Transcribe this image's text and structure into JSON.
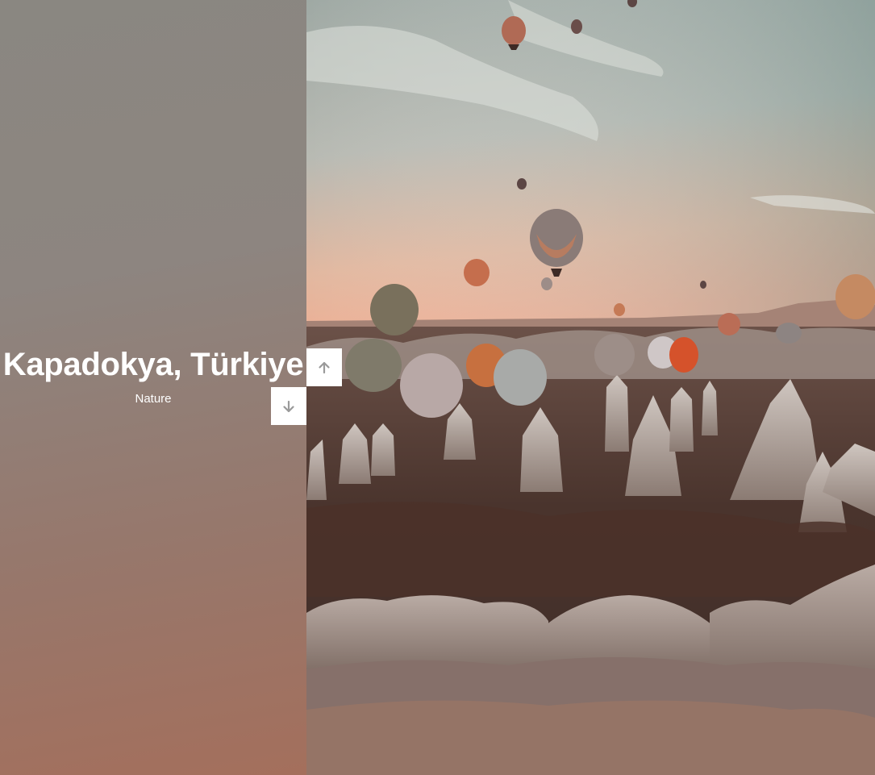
{
  "slide": {
    "title": "Kapadokya, Türkiye",
    "category": "Nature"
  },
  "controls": {
    "up_icon": "arrow-up-icon",
    "down_icon": "arrow-down-icon"
  },
  "colors": {
    "left_gradient_top": "#8a8781",
    "left_gradient_bottom": "#a46f5c",
    "button_bg": "#ffffff",
    "icon_color": "#9a9a9a"
  }
}
